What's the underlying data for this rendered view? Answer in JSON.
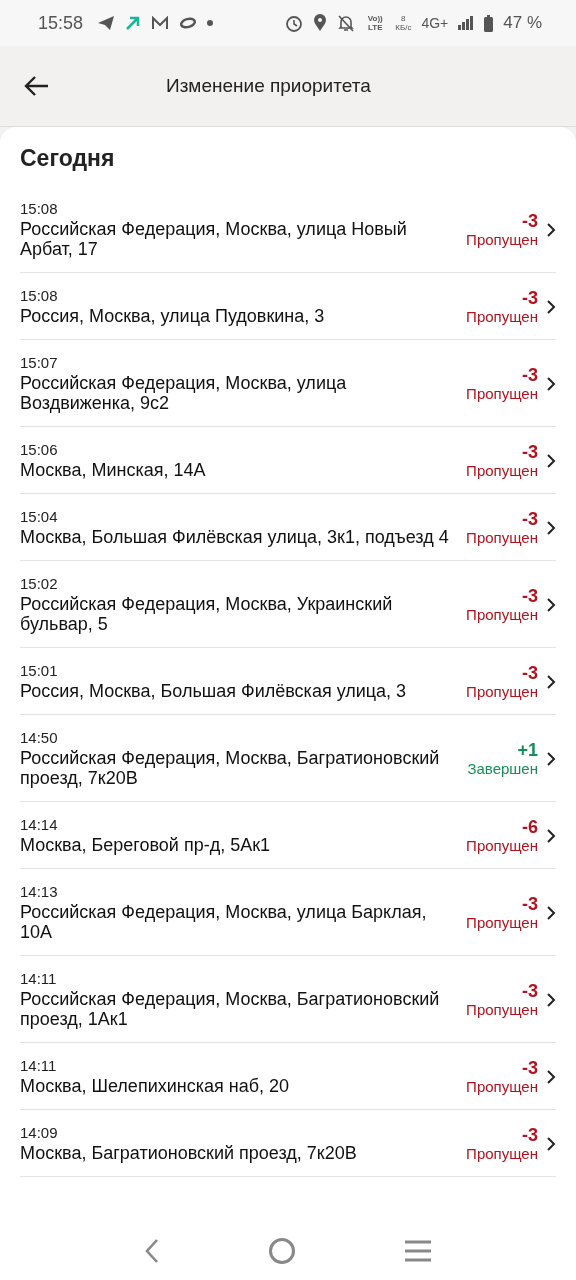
{
  "status_bar": {
    "time": "15:58",
    "net_speed_value": "8",
    "net_speed_unit": "КБ/с",
    "volte": "Vo)) LTE",
    "network": "4G+",
    "battery": "47 %"
  },
  "app_bar": {
    "title": "Изменение приоритета"
  },
  "section": {
    "title": "Сегодня"
  },
  "rows": [
    {
      "time": "15:08",
      "address": "Российская Федерация, Москва, улица Новый Арбат, 17",
      "points": "-3",
      "status": "Пропущен",
      "kind": "skipped"
    },
    {
      "time": "15:08",
      "address": "Россия, Москва, улица Пудовкина, 3",
      "points": "-3",
      "status": "Пропущен",
      "kind": "skipped"
    },
    {
      "time": "15:07",
      "address": "Российская Федерация, Москва, улица Воздвиженка, 9с2",
      "points": "-3",
      "status": "Пропущен",
      "kind": "skipped"
    },
    {
      "time": "15:06",
      "address": "Москва, Минская, 14А",
      "points": "-3",
      "status": "Пропущен",
      "kind": "skipped"
    },
    {
      "time": "15:04",
      "address": "Москва, Большая Филёвская улица, 3к1, подъезд 4",
      "points": "-3",
      "status": "Пропущен",
      "kind": "skipped"
    },
    {
      "time": "15:02",
      "address": "Российская Федерация, Москва, Украинский бульвар, 5",
      "points": "-3",
      "status": "Пропущен",
      "kind": "skipped"
    },
    {
      "time": "15:01",
      "address": "Россия, Москва, Большая Филёвская улица, 3",
      "points": "-3",
      "status": "Пропущен",
      "kind": "skipped"
    },
    {
      "time": "14:50",
      "address": "Российская Федерация, Москва, Багратионовский проезд, 7к20В",
      "points": "+1",
      "status": "Завершен",
      "kind": "completed"
    },
    {
      "time": "14:14",
      "address": "Москва, Береговой пр-д, 5Ак1",
      "points": "-6",
      "status": "Пропущен",
      "kind": "skipped"
    },
    {
      "time": "14:13",
      "address": "Российская Федерация, Москва, улица Барклая, 10А",
      "points": "-3",
      "status": "Пропущен",
      "kind": "skipped"
    },
    {
      "time": "14:11",
      "address": "Российская Федерация, Москва, Багратионовский проезд, 1Ак1",
      "points": "-3",
      "status": "Пропущен",
      "kind": "skipped"
    },
    {
      "time": "14:11",
      "address": "Москва, Шелепихинская наб, 20",
      "points": "-3",
      "status": "Пропущен",
      "kind": "skipped"
    },
    {
      "time": "14:09",
      "address": "Москва, Багратионовский проезд, 7к20В",
      "points": "-3",
      "status": "Пропущен",
      "kind": "skipped"
    }
  ]
}
